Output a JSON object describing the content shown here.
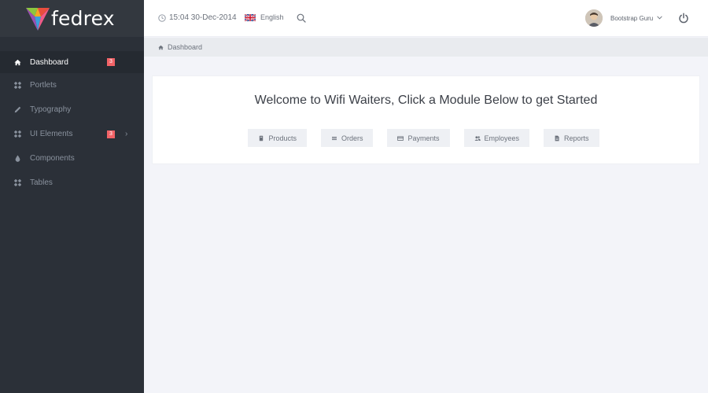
{
  "brand": {
    "name": "fedrex"
  },
  "header": {
    "clock": "15:04 30-Dec-2014",
    "language": "English",
    "user_name": "Bootstrap Guru"
  },
  "breadcrumb": {
    "current": "Dashboard"
  },
  "sidebar": {
    "items": [
      {
        "label": "Dashboard",
        "icon": "home-icon",
        "active": true,
        "badge": "3"
      },
      {
        "label": "Portlets",
        "icon": "grid-icon"
      },
      {
        "label": "Typography",
        "icon": "pencil-icon"
      },
      {
        "label": "UI Elements",
        "icon": "grid-icon",
        "badge": "3",
        "has_submenu": true
      },
      {
        "label": "Components",
        "icon": "drop-icon"
      },
      {
        "label": "Tables",
        "icon": "grid-icon"
      }
    ]
  },
  "main": {
    "welcome_title": "Welcome to Wifi Waiters, Click a Module Below to get Started",
    "modules": [
      {
        "label": "Products",
        "icon": "box-icon"
      },
      {
        "label": "Orders",
        "icon": "list-icon"
      },
      {
        "label": "Payments",
        "icon": "card-icon"
      },
      {
        "label": "Employees",
        "icon": "users-icon"
      },
      {
        "label": "Reports",
        "icon": "document-icon"
      }
    ]
  },
  "colors": {
    "sidebar_bg": "#2b3038",
    "badge": "#f26367",
    "page_bg": "#f3f4f9"
  }
}
